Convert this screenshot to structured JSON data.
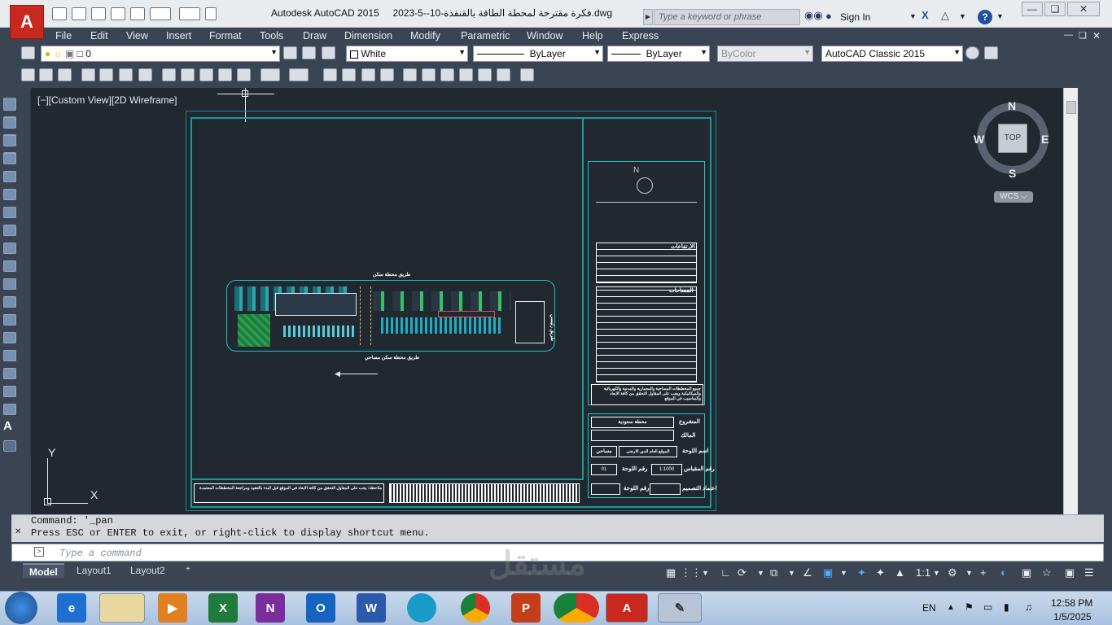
{
  "title_bar": {
    "app_name": "Autodesk AutoCAD 2015",
    "doc_name": "فكرة مقترحة لمحطة الطاقة بالقنفذة-10--5-2023.dwg",
    "search_placeholder": "Type a keyword or phrase",
    "sign_in": "Sign In",
    "logo_letter": "A",
    "help_icon": "?"
  },
  "menu": [
    "File",
    "Edit",
    "View",
    "Insert",
    "Format",
    "Tools",
    "Draw",
    "Dimension",
    "Modify",
    "Parametric",
    "Window",
    "Help",
    "Express"
  ],
  "properties_toolbar": {
    "layer": "0",
    "color": "White",
    "linetype": "ByLayer",
    "lineweight": "ByLayer",
    "plotstyle": "ByColor",
    "workspace": "AutoCAD Classic 2015"
  },
  "viewport": {
    "label": "[−][Custom View][2D Wireframe]",
    "viewcube_top": "TOP",
    "compass_n": "N",
    "compass_e": "E",
    "compass_s": "S",
    "compass_w": "W",
    "wcs": "WCS ⌵",
    "ucs_x": "X",
    "ucs_y": "Y"
  },
  "drawing": {
    "legend_header_1": "الارتفاعات",
    "legend_header_2": "المساحات",
    "title_project": "المشروع",
    "title_project_value": "محطة سعودية",
    "title_owner": "المالك",
    "title_sheet_name": "اسم اللوحة",
    "title_sheet_value": "الموقع العام الدور الارضي",
    "title_sheet_scale": "مساحي",
    "title_scale": "رقم المقياس",
    "title_scale_value": "1:1000",
    "title_sheet_no": "رقم اللوحة",
    "title_sheet_no_value": "01",
    "title_design": "اعتماد التصميم",
    "title_plan_no": "رقم اللوحة",
    "notes_text": "جميع المخططات المساحية والمعمارية والمدنية والكهربائية والميكانيكية ويجب على المقاول التحقق من كافة الابعاد والمناسيب في الموقع",
    "street_top": "طريق محطة سكن",
    "street_bottom": "طريق محطة سكن مساحي",
    "street_right": "طريق رئيسي",
    "north_label": "N",
    "footer_notes": "ملاحظة: يجب على المقاول التحقق من كافة الابعاد في الموقع قبل البدء بالتنفيذ ومراجعة المخططات المعتمدة"
  },
  "command": {
    "line1": "Command: '_pan",
    "line2": "Press ESC or ENTER to exit, or right-click to display shortcut menu.",
    "placeholder": "Type a command"
  },
  "layout_tabs": [
    "Model",
    "Layout1",
    "Layout2",
    "+"
  ],
  "status": {
    "scale": "1:1"
  },
  "taskbar": {
    "lang": "EN",
    "time": "12:58 PM",
    "date": "1/5/2025",
    "watermark": "مستقل"
  }
}
